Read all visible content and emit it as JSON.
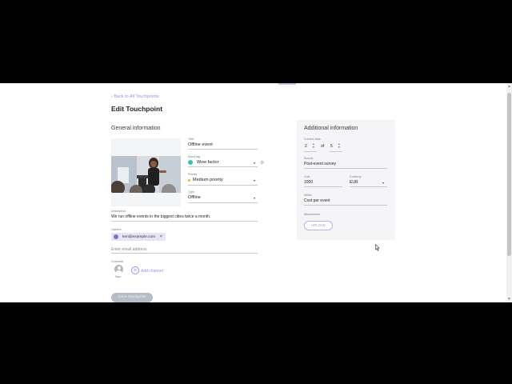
{
  "nav": {
    "back_label": "Back to All Touchpoints"
  },
  "page": {
    "title": "Edit Touchpoint"
  },
  "general": {
    "section_title": "General information",
    "title": {
      "label": "Title*",
      "value": "Offline event"
    },
    "mood_tag": {
      "label": "Mood tag",
      "value": "Wow factor"
    },
    "priority": {
      "label": "Priority",
      "value": "Medium priority"
    },
    "type": {
      "label": "Type",
      "value": "Offline"
    },
    "description": {
      "label": "Description",
      "value": "We run offline events in the biggest cities twice a month."
    },
    "owners": {
      "label": "Owners",
      "chip": "ken@example.com",
      "placeholder": "Enter email address"
    },
    "channels": {
      "label": "Channels",
      "channel_name": "Sam",
      "add_label": "Add channel"
    },
    "save_label": "Save Touchpoint"
  },
  "additional": {
    "section_title": "Additional information",
    "current_state": {
      "label": "Current state",
      "value": "2",
      "of_text": "of",
      "total": "5"
    },
    "source": {
      "label": "Source",
      "value": "Post-event survey"
    },
    "cost": {
      "label": "Cost",
      "value": "1000"
    },
    "currency": {
      "label": "Currency",
      "value": "EUR"
    },
    "metric": {
      "label": "Metric",
      "value": "Cost per event"
    },
    "attachments": {
      "label": "Attachments",
      "upload_label": "UPLOAD"
    }
  },
  "colors": {
    "accent": "#9b8fe0",
    "mood_tag": "#2fc4b6",
    "priority": "#e8b93a",
    "save_disabled": "#b5bec6",
    "panel_bg": "#f5f5f7"
  }
}
